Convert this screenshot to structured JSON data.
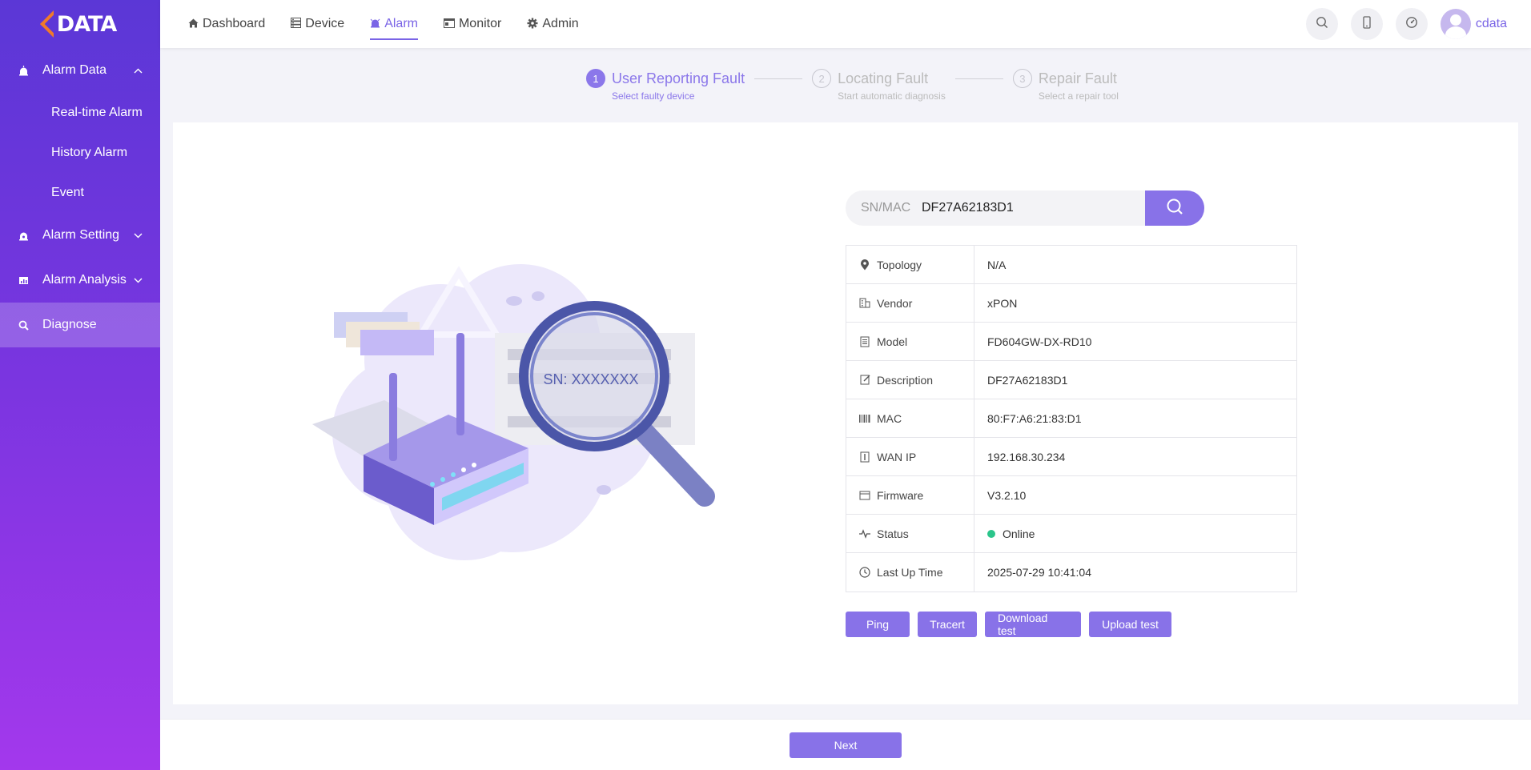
{
  "logo": {
    "text": "DATA"
  },
  "sidebar": {
    "groups": [
      {
        "label": "Alarm Data",
        "chevron": "up",
        "icon": "alarm-data-icon",
        "items": [
          {
            "label": "Real-time Alarm"
          },
          {
            "label": "History Alarm"
          },
          {
            "label": "Event"
          }
        ]
      },
      {
        "label": "Alarm Setting",
        "chevron": "down",
        "icon": "alarm-setting-icon"
      },
      {
        "label": "Alarm Analysis",
        "chevron": "down",
        "icon": "alarm-analysis-icon"
      },
      {
        "label": "Diagnose",
        "icon": "diagnose-icon",
        "active": true
      }
    ]
  },
  "topnav": {
    "items": [
      {
        "label": "Dashboard",
        "icon": "home-icon"
      },
      {
        "label": "Device",
        "icon": "device-icon"
      },
      {
        "label": "Alarm",
        "icon": "alarm-icon",
        "active": true
      },
      {
        "label": "Monitor",
        "icon": "monitor-icon"
      },
      {
        "label": "Admin",
        "icon": "gear-icon"
      }
    ],
    "username": "cdata"
  },
  "steps": [
    {
      "num": "1",
      "title": "User Reporting Fault",
      "desc": "Select faulty device",
      "active": true
    },
    {
      "num": "2",
      "title": "Locating Fault",
      "desc": "Start automatic diagnosis"
    },
    {
      "num": "3",
      "title": "Repair Fault",
      "desc": "Select a repair tool"
    }
  ],
  "illustration": {
    "sn_text": "SN: XXXXXXX"
  },
  "search": {
    "label": "SN/MAC",
    "value": "DF27A62183D1"
  },
  "info": {
    "rows": [
      {
        "key": "Topology",
        "value": "N/A",
        "icon": "location-pin-icon"
      },
      {
        "key": "Vendor",
        "value": "xPON",
        "icon": "building-icon"
      },
      {
        "key": "Model",
        "value": "FD604GW-DX-RD10",
        "icon": "document-icon"
      },
      {
        "key": "Description",
        "value": "DF27A62183D1",
        "icon": "edit-icon"
      },
      {
        "key": "MAC",
        "value": "80:F7:A6:21:83:D1",
        "icon": "barcode-icon"
      },
      {
        "key": "WAN IP",
        "value": "192.168.30.234",
        "icon": "ip-icon"
      },
      {
        "key": "Firmware",
        "value": "V3.2.10",
        "icon": "firmware-icon"
      },
      {
        "key": "Status",
        "value": "Online",
        "icon": "pulse-icon",
        "status_color": "#2bc58b"
      },
      {
        "key": "Last Up Time",
        "value": "2025-07-29 10:41:04",
        "icon": "clock-icon"
      }
    ]
  },
  "actions": {
    "ping": "Ping",
    "tracert": "Tracert",
    "download": "Download test",
    "upload": "Upload test"
  },
  "footer": {
    "next": "Next"
  },
  "colors": {
    "accent": "#8872e8",
    "online": "#2bc58b",
    "orange": "#f07a2a"
  }
}
